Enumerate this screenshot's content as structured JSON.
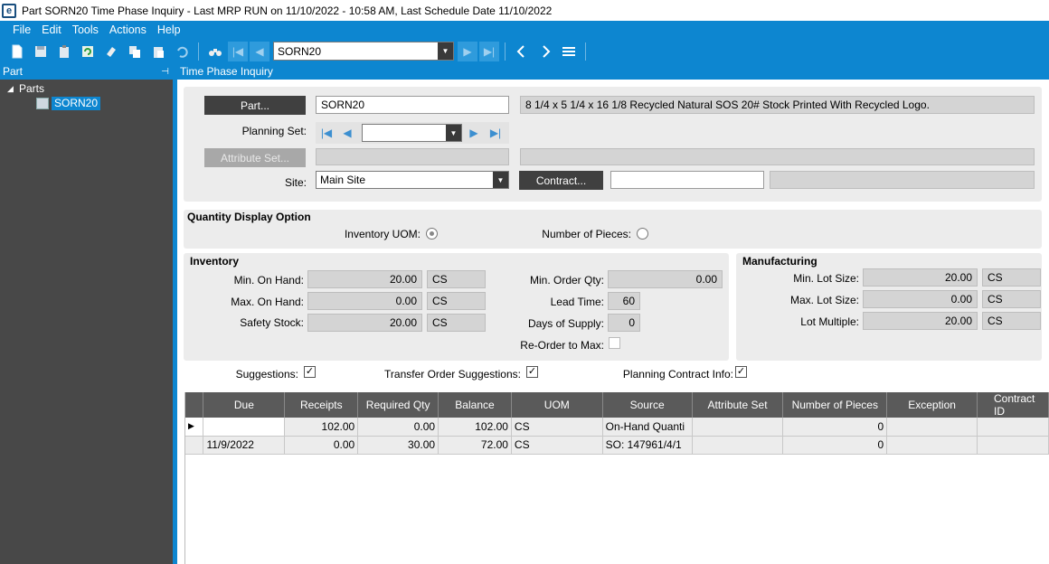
{
  "window": {
    "title": "Part SORN20 Time Phase Inquiry  - Last MRP RUN on 11/10/2022 - 10:58 AM, Last Schedule Date  11/10/2022",
    "logo": "e"
  },
  "menu": [
    "File",
    "Edit",
    "Tools",
    "Actions",
    "Help"
  ],
  "toolbar": {
    "combo_value": "SORN20"
  },
  "left_panel": {
    "title": "Part",
    "tree_root": "Parts",
    "tree_item": "SORN20"
  },
  "main": {
    "title": "Time Phase Inquiry"
  },
  "part": {
    "part_button": "Part...",
    "part_value": "SORN20",
    "description": "8 1/4 x 5 1/4 x 16 1/8 Recycled Natural SOS 20# Stock Printed With Recycled Logo.",
    "planning_set_label": "Planning Set:",
    "attribute_button": "Attribute Set...",
    "site_label": "Site:",
    "site_value": "Main Site",
    "contract_button": "Contract..."
  },
  "qty_display": {
    "title": "Quantity Display Option",
    "inventory_uom_label": "Inventory UOM:",
    "pieces_label": "Number of Pieces:"
  },
  "inventory": {
    "title": "Inventory",
    "min_on_hand_label": "Min. On Hand:",
    "min_on_hand": "20.00",
    "min_on_hand_uom": "CS",
    "max_on_hand_label": "Max. On Hand:",
    "max_on_hand": "0.00",
    "max_on_hand_uom": "CS",
    "safety_stock_label": "Safety Stock:",
    "safety_stock": "20.00",
    "safety_stock_uom": "CS",
    "min_order_label": "Min. Order Qty:",
    "min_order": "0.00",
    "lead_time_label": "Lead Time:",
    "lead_time": "60",
    "days_supply_label": "Days of Supply:",
    "days_supply": "0",
    "reorder_label": "Re-Order to Max:"
  },
  "manufacturing": {
    "title": "Manufacturing",
    "min_lot_label": "Min. Lot Size:",
    "min_lot": "20.00",
    "min_lot_uom": "CS",
    "max_lot_label": "Max. Lot Size:",
    "max_lot": "0.00",
    "max_lot_uom": "CS",
    "lot_mult_label": "Lot Multiple:",
    "lot_mult": "20.00",
    "lot_mult_uom": "CS"
  },
  "options": {
    "suggestions_label": "Suggestions:",
    "transfer_label": "Transfer Order Suggestions:",
    "planning_contract_label": "Planning Contract Info:"
  },
  "grid": {
    "columns": [
      "Due",
      "Receipts",
      "Required Qty",
      "Balance",
      "UOM",
      "Source",
      "Attribute Set",
      "Number of Pieces",
      "Exception",
      "Contract ID"
    ],
    "rows": [
      [
        "",
        "102.00",
        "0.00",
        "102.00",
        "CS",
        "On-Hand Quanti",
        "",
        "0",
        "",
        ""
      ],
      [
        "11/9/2022",
        "0.00",
        "30.00",
        "72.00",
        "CS",
        "SO: 147961/4/1",
        "",
        "0",
        "",
        ""
      ]
    ]
  }
}
